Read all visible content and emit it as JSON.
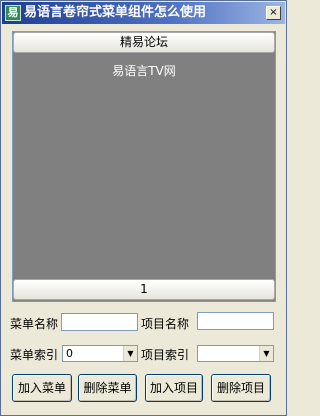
{
  "window": {
    "title": "易语言卷帘式菜单组件怎么使用",
    "app_icon_glyph": "易",
    "close_glyph": "×"
  },
  "outlook": {
    "menu_title": "精易论坛",
    "items": [
      "易语言TV网"
    ],
    "bottom_menu": "1"
  },
  "form": {
    "menu_name_label": "菜单名称",
    "menu_name_value": "",
    "item_name_label": "项目名称",
    "item_name_value": "",
    "menu_index_label": "菜单索引",
    "menu_index_value": "0",
    "item_index_label": "项目索引",
    "item_index_value": ""
  },
  "buttons": {
    "add_menu": "加入菜单",
    "delete_menu": "删除菜单",
    "add_item": "加入项目",
    "delete_item": "删除项目"
  },
  "icons": {
    "app": "app-icon",
    "close": "close-icon",
    "dropdown": "chevron-down-icon"
  }
}
